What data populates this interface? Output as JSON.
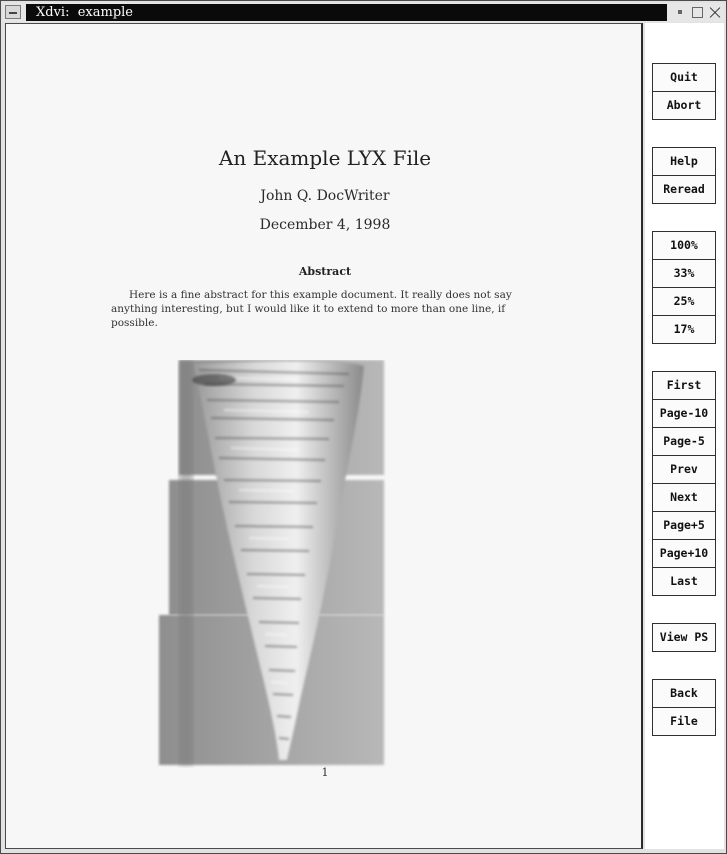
{
  "window": {
    "title": "Xdvi:  example"
  },
  "document": {
    "title": "An Example LYX File",
    "author": "John Q. DocWriter",
    "date": "December 4, 1998",
    "abstract_heading": "Abstract",
    "abstract_text": "Here is a fine abstract for this example document. It really does not say anything interesting, but I would like it to extend to more than one line, if possible.",
    "page_number": "1"
  },
  "buttons": {
    "group1": [
      "Quit",
      "Abort"
    ],
    "group2": [
      "Help",
      "Reread"
    ],
    "group3": [
      "100%",
      "33%",
      "25%",
      "17%"
    ],
    "group4": [
      "First",
      "Page-10",
      "Page-5",
      "Prev",
      "Next",
      "Page+5",
      "Page+10",
      "Last"
    ],
    "group5": [
      "View PS"
    ],
    "group6": [
      "Back",
      "File"
    ]
  }
}
